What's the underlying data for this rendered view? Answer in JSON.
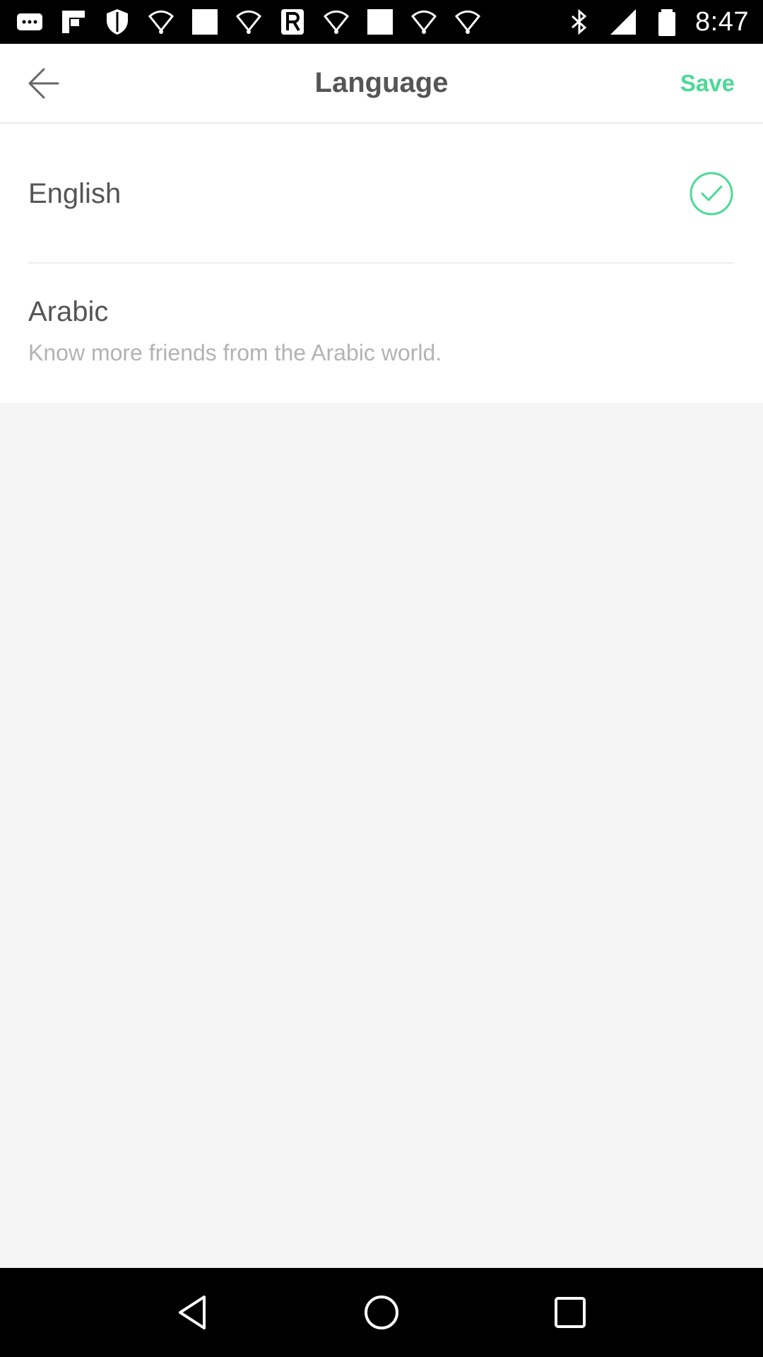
{
  "status_bar": {
    "time": "8:47",
    "left_icons": [
      "more-icon",
      "flipboard-icon",
      "shield-icon",
      "wifi-signal-icon",
      "square-icon",
      "wifi-signal-icon",
      "r-app-icon",
      "wifi-signal-icon",
      "square-icon",
      "wifi-signal-icon",
      "wifi-signal-icon"
    ],
    "right_icons": [
      "bluetooth-icon",
      "signal-icon",
      "battery-icon"
    ]
  },
  "app_bar": {
    "title": "Language",
    "save_label": "Save",
    "accent_color": "#4cd996"
  },
  "languages": [
    {
      "name": "English",
      "description": "",
      "selected": true
    },
    {
      "name": "Arabic",
      "description": "Know more friends from the Arabic world.",
      "selected": false
    }
  ],
  "nav_bar": {
    "buttons": [
      "back-triangle-icon",
      "home-circle-icon",
      "recents-square-icon"
    ]
  }
}
